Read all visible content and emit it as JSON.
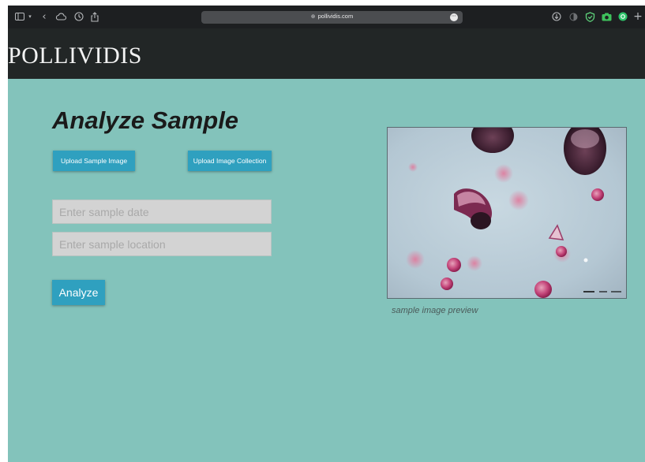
{
  "browser": {
    "url": "pollividis.com",
    "icons": [
      "sidebar-icon",
      "chevron-down-icon",
      "back-icon",
      "cloud-icon",
      "clock-icon",
      "share-icon",
      "globe-icon",
      "more-icon",
      "download-icon",
      "shield-icon",
      "camera-icon",
      "circle-extension-icon",
      "plus-icon"
    ]
  },
  "header": {
    "logo": "POLLIVIDIS"
  },
  "main": {
    "title": "Analyze Sample",
    "upload_sample_label": "Upload Sample Image",
    "upload_collection_label": "Upload Image Collection",
    "date_placeholder": "Enter sample date",
    "location_placeholder": "Enter sample location",
    "analyze_label": "Analyze",
    "preview_caption": "sample image preview"
  },
  "colors": {
    "background": "#83c3bb",
    "header": "#222626",
    "accent": "#2fa0bf",
    "chrome": "#1d1f21"
  }
}
